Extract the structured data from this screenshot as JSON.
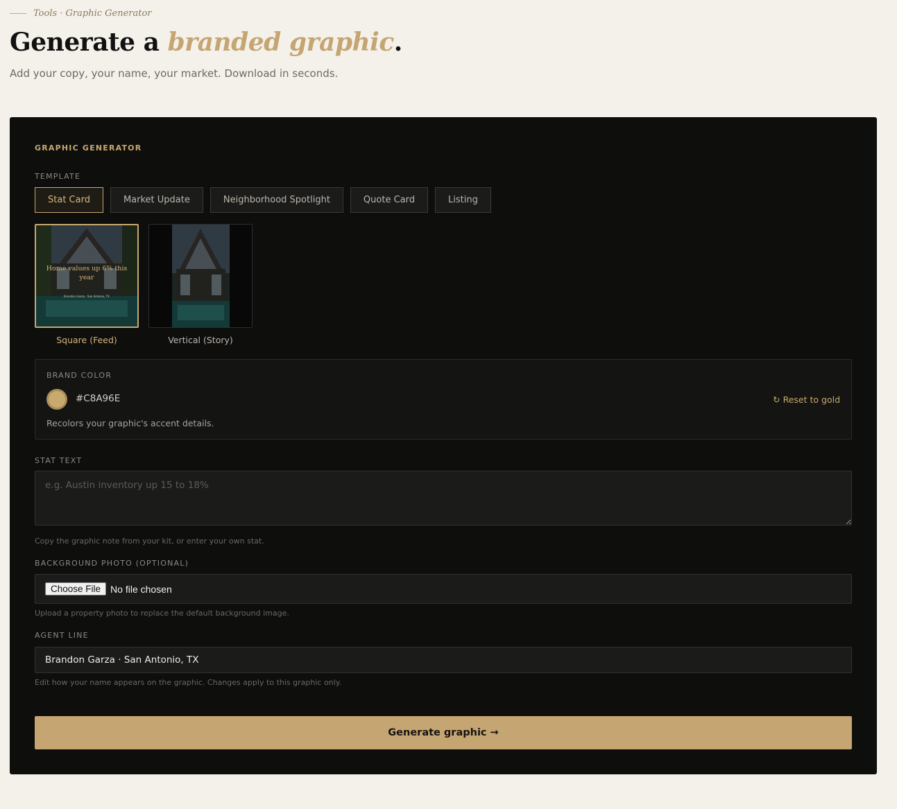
{
  "breadcrumb": "Tools · Graphic Generator",
  "headline": {
    "prefix": "Generate a ",
    "accent": "branded graphic",
    "suffix": "."
  },
  "subhead": "Add your copy, your name, your market. Download in seconds.",
  "panel": {
    "section_title": "Graphic Generator",
    "template_label": "Template",
    "templates": [
      {
        "label": "Stat Card",
        "active": true
      },
      {
        "label": "Market Update",
        "active": false
      },
      {
        "label": "Neighborhood Spotlight",
        "active": false
      },
      {
        "label": "Quote Card",
        "active": false
      },
      {
        "label": "Listing",
        "active": false
      }
    ],
    "formats": [
      {
        "label": "Square (Feed)",
        "active": true
      },
      {
        "label": "Vertical (Story)",
        "active": false
      }
    ],
    "preview": {
      "stat": "Home values up 6% this year",
      "agent": "Brandon Garza · San Antonio, TX"
    },
    "brand_color": {
      "label": "Brand Color",
      "hex": "#C8A96E",
      "reset_label": "Reset to gold",
      "reset_icon": "refresh-icon",
      "help": "Recolors your graphic's accent details."
    },
    "stat_text": {
      "label": "Stat Text",
      "placeholder": "e.g. Austin inventory up 15 to 18%",
      "value": "",
      "help": "Copy the graphic note from your kit, or enter your own stat."
    },
    "background_photo": {
      "label": "Background Photo (Optional)",
      "button": "Choose File",
      "status": "No file chosen",
      "help": "Upload a property photo to replace the default background image."
    },
    "agent_line": {
      "label": "Agent Line",
      "value": "Brandon Garza · San Antonio, TX",
      "help": "Edit how your name appears on the graphic. Changes apply to this graphic only."
    },
    "generate_label": "Generate graphic →"
  },
  "colors": {
    "accent": "#C8A96E",
    "page_bg": "#F4F1EA",
    "panel_bg": "#0E0E0D",
    "button_bg": "#C5A571"
  }
}
